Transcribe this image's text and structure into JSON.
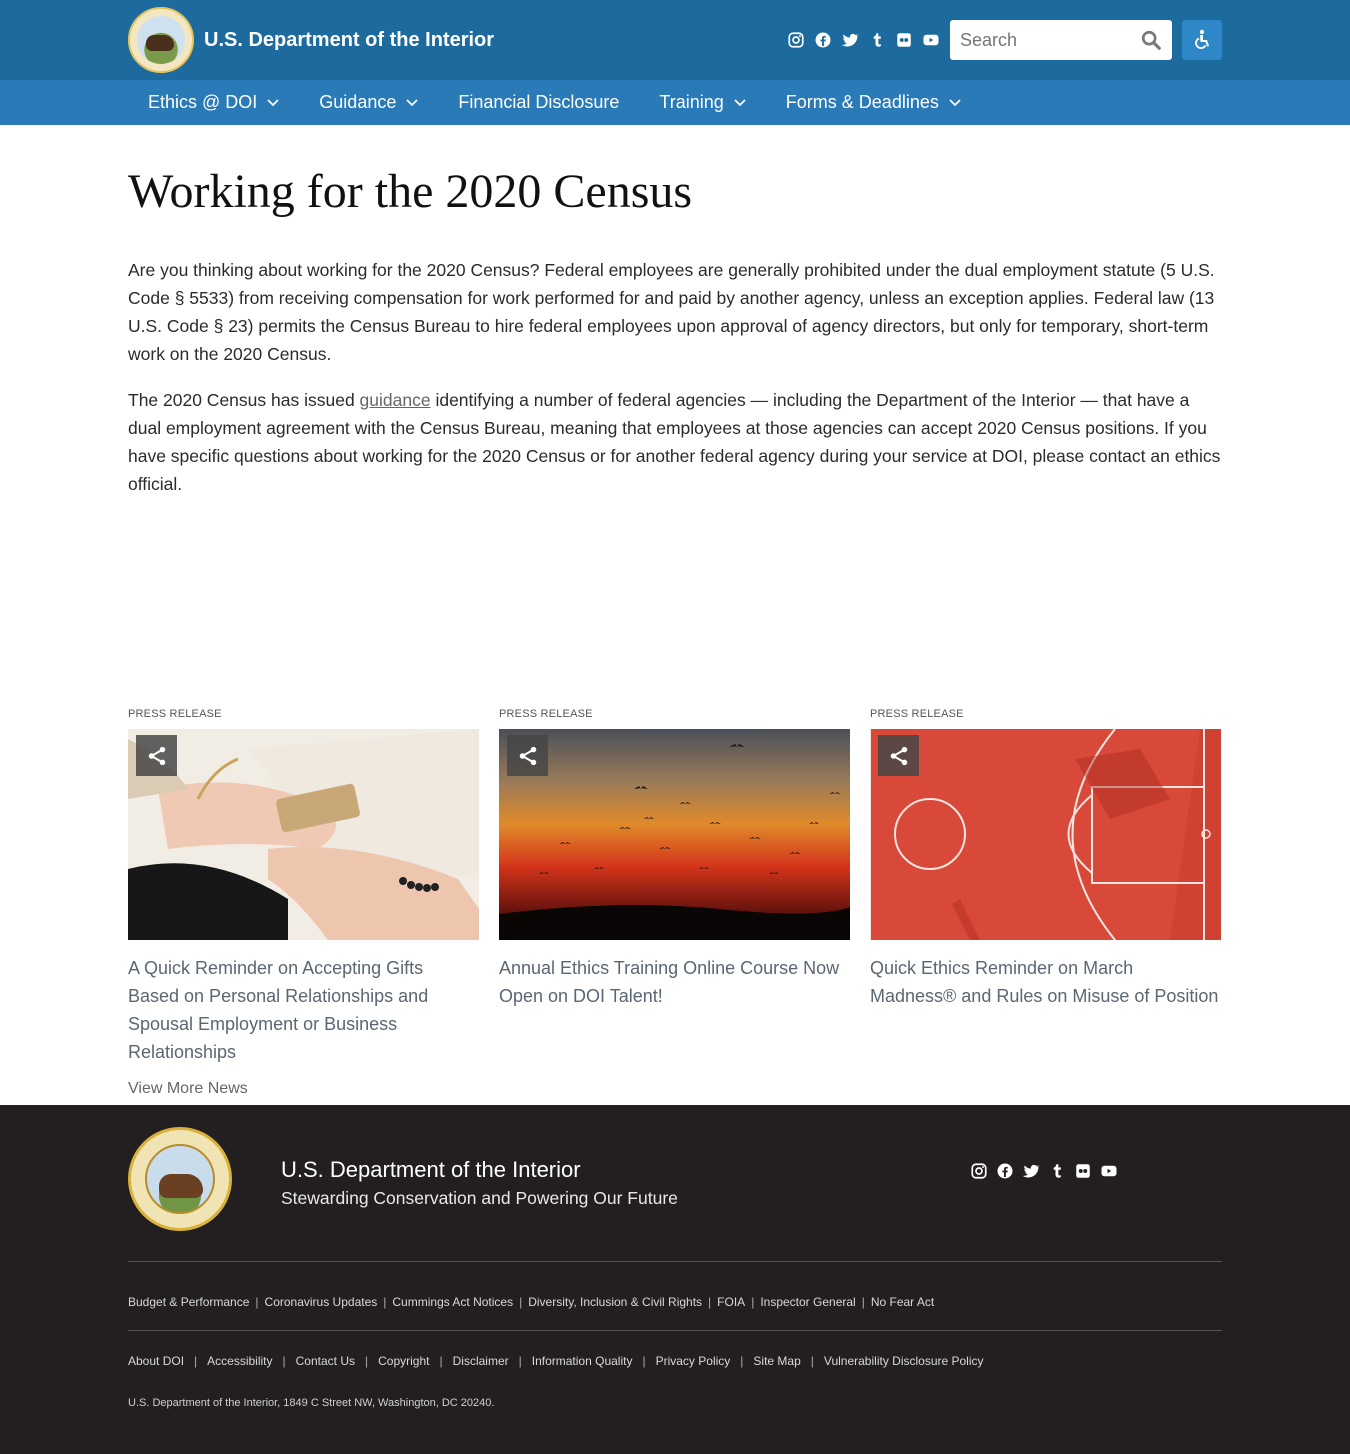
{
  "header": {
    "site_title": "U.S. Department of the Interior",
    "search_placeholder": "Search",
    "social_icons": [
      "instagram-icon",
      "facebook-icon",
      "twitter-icon",
      "tumblr-icon",
      "flickr-icon",
      "youtube-icon"
    ],
    "accessibility_icon": "accessibility-icon"
  },
  "nav": {
    "items": [
      {
        "label": "Ethics @ DOI",
        "has_dropdown": true
      },
      {
        "label": "Guidance",
        "has_dropdown": true
      },
      {
        "label": "Financial Disclosure",
        "has_dropdown": false
      },
      {
        "label": "Training",
        "has_dropdown": true
      },
      {
        "label": "Forms & Deadlines",
        "has_dropdown": true
      }
    ]
  },
  "main": {
    "title": "Working for the 2020 Census",
    "para1": "Are you thinking about working for the 2020 Census?  Federal employees are generally prohibited under the dual employment statute (5 U.S. Code § 5533) from receiving compensation for work performed for and paid by another agency, unless an exception applies. Federal law (13 U.S. Code § 23) permits the Census Bureau to hire federal employees upon approval of agency directors, but only for temporary, short-term work on the 2020 Census.",
    "para2_before": "The 2020 Census has issued ",
    "para2_link": "guidance",
    "para2_after": " identifying a number of federal agencies — including the Department of the Interior — that have a dual employment agreement with the Census Bureau, meaning that employees at those agencies can accept 2020 Census positions. If you have specific questions about working for the 2020 Census or for another federal agency during your service at DOI, please contact an ethics official."
  },
  "news": {
    "cards": [
      {
        "kicker": "PRESS RELEASE",
        "title": "A Quick Reminder on Accepting Gifts Based on Personal Relationships and Spousal Employment or Business Relationships"
      },
      {
        "kicker": "PRESS RELEASE",
        "title": "Annual Ethics Training Online Course Now Open on DOI Talent!"
      },
      {
        "kicker": "PRESS RELEASE",
        "title": "Quick Ethics Reminder on March Madness® and Rules on Misuse of Position"
      }
    ],
    "view_more": "View More News"
  },
  "footer": {
    "title": "U.S. Department of the Interior",
    "subtitle": "Stewarding Conservation and Powering Our Future",
    "links_row1": [
      "Budget & Performance",
      "Coronavirus Updates",
      "Cummings Act Notices",
      "Diversity, Inclusion & Civil Rights",
      "FOIA",
      "Inspector General",
      "No Fear Act"
    ],
    "links_row2": [
      "About DOI",
      "Accessibility",
      "Contact Us",
      "Copyright",
      "Disclaimer",
      "Information Quality",
      "Privacy Policy",
      "Site Map",
      "Vulnerability Disclosure Policy"
    ],
    "address": "U.S. Department of the Interior, 1849 C Street NW, Washington, DC 20240."
  },
  "colors": {
    "header_bg": "#1d6a9e",
    "nav_bg": "#2a7ab7",
    "footer_bg": "#231f20"
  }
}
